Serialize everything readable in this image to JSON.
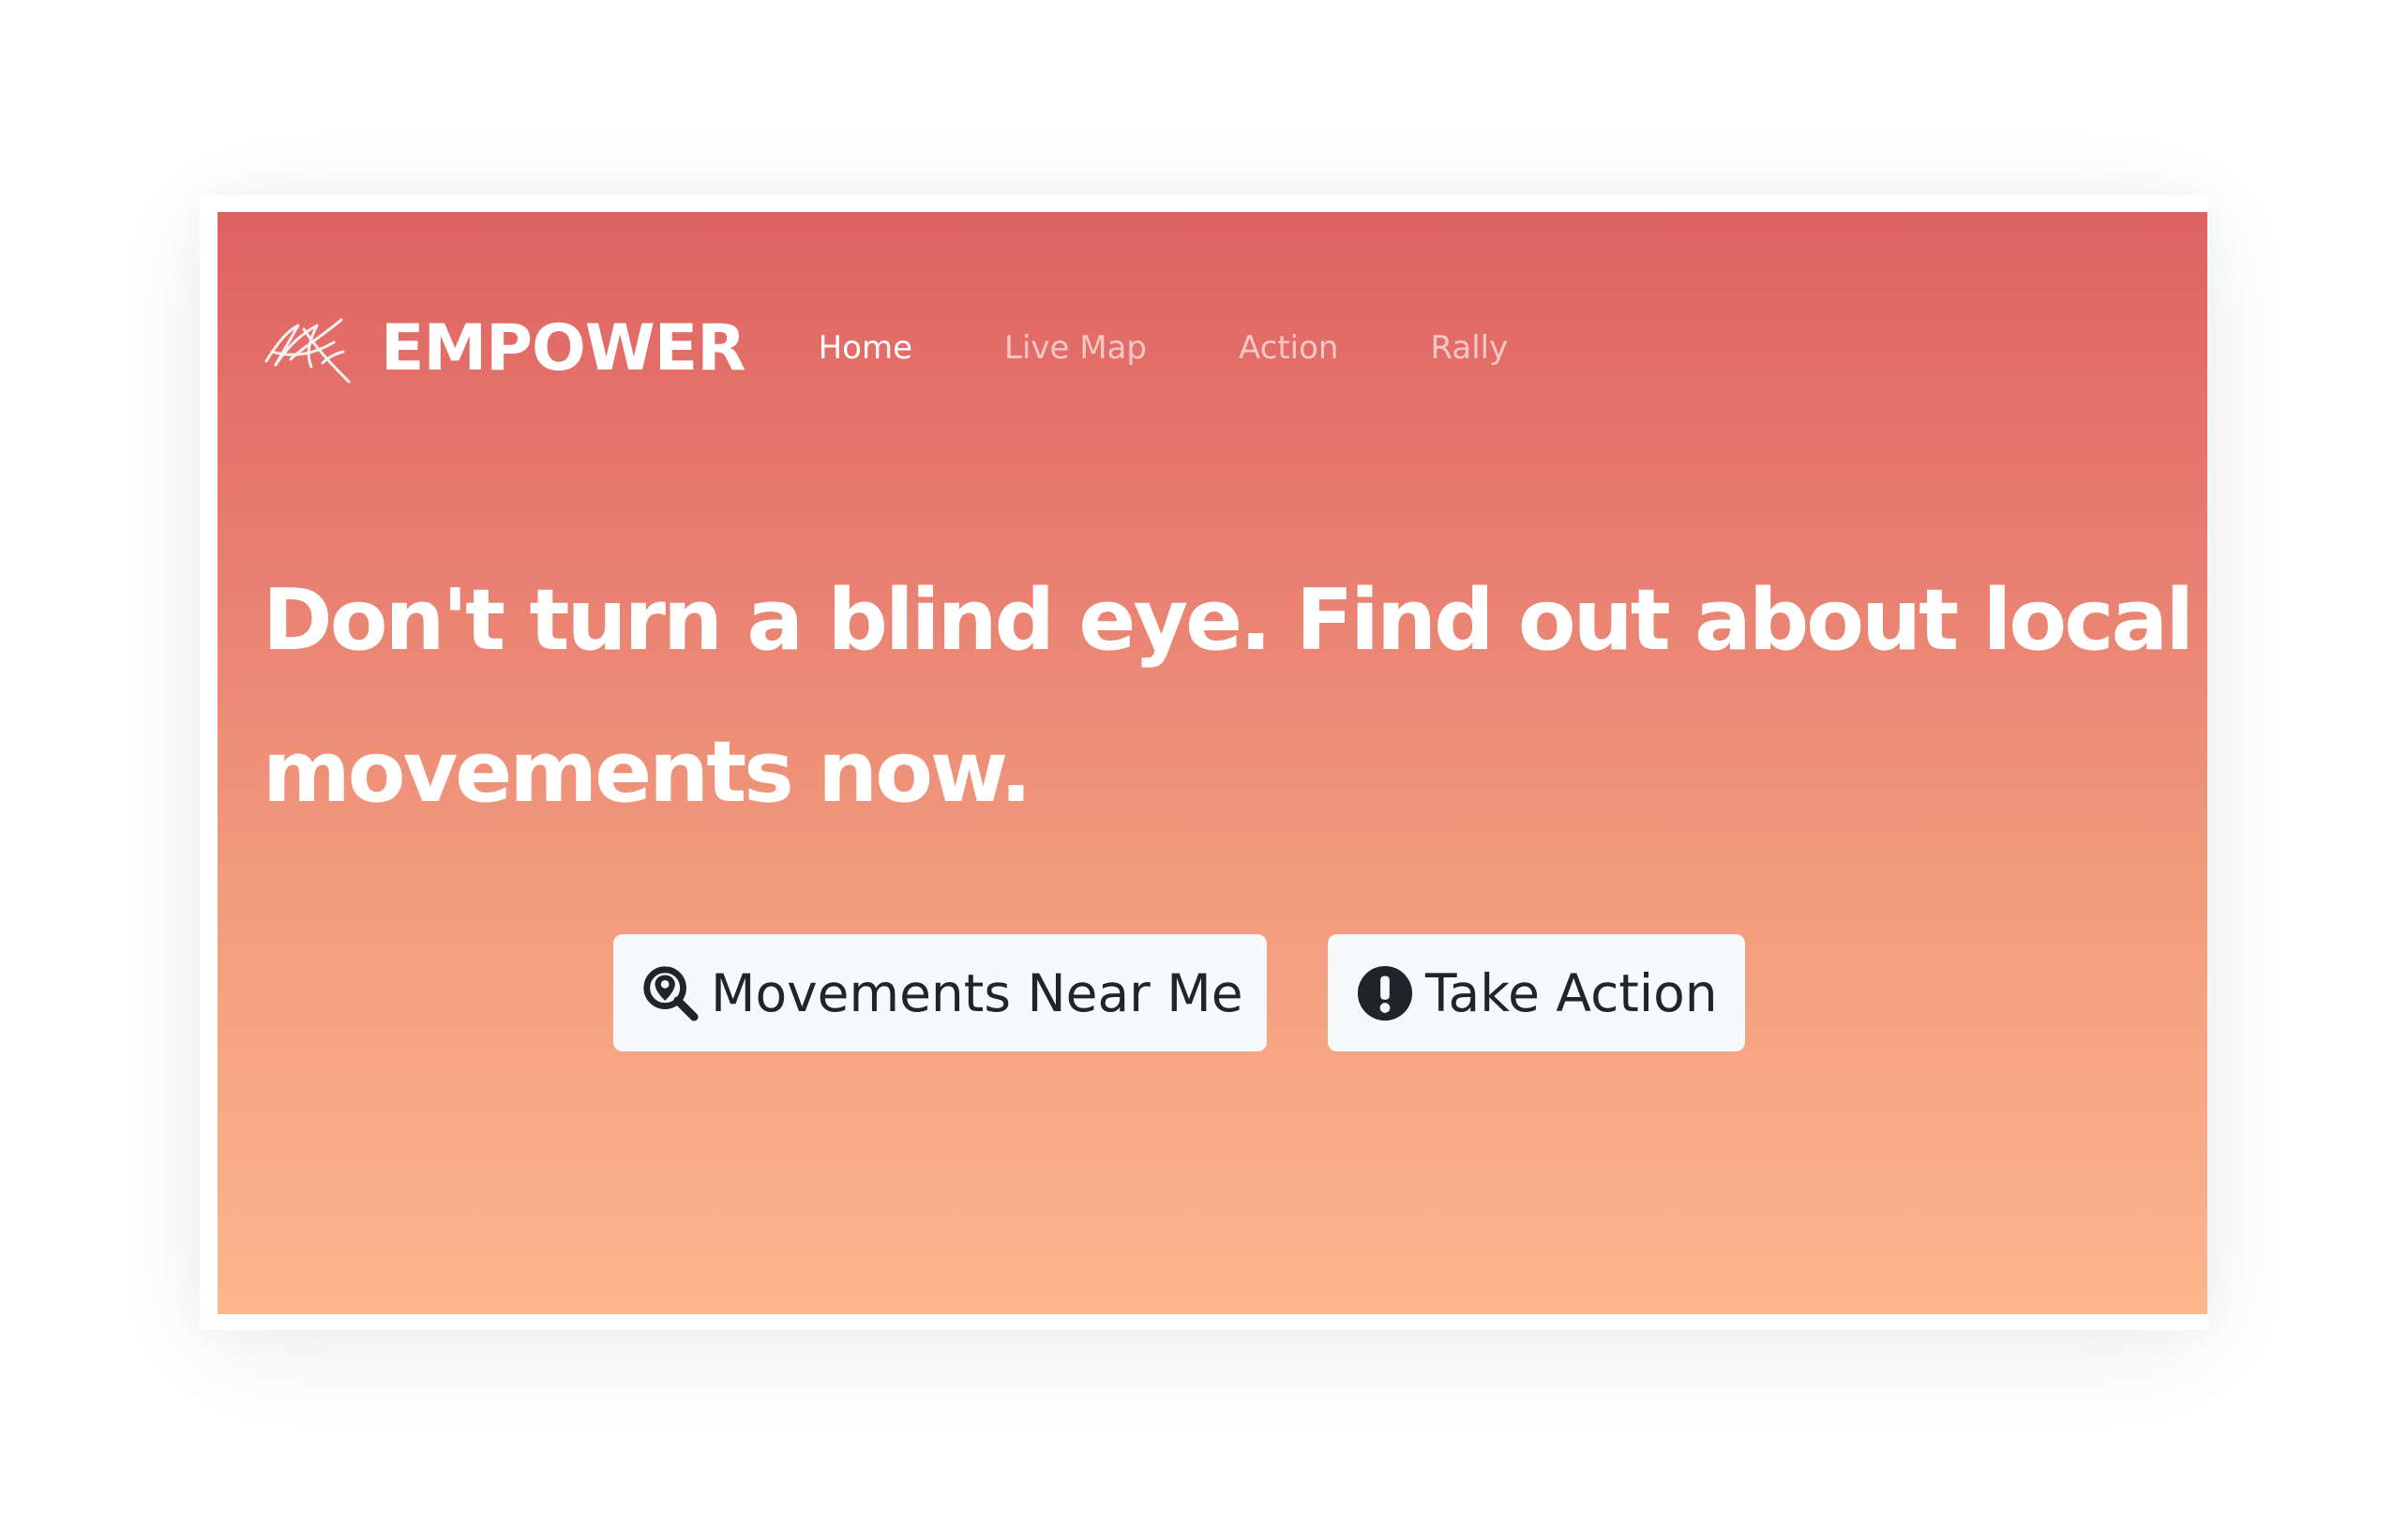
{
  "brand": {
    "name": "EMPOWER",
    "logo_icon": "scribble-logo-icon"
  },
  "nav": {
    "items": [
      {
        "label": "Home",
        "active": true
      },
      {
        "label": "Live Map",
        "active": false
      },
      {
        "label": "Action",
        "active": false
      },
      {
        "label": "Rally",
        "active": false
      }
    ]
  },
  "hero": {
    "headline_line1": "Don't turn a blind eye. Find out about local",
    "headline_line2": "movements now.",
    "gradient_top": "#df6262",
    "gradient_bottom": "#fdb68c"
  },
  "buttons": {
    "movements": {
      "label": "Movements Near Me",
      "icon": "search-location-icon"
    },
    "take_action": {
      "label": "Take Action",
      "icon": "exclamation-circle-icon"
    }
  }
}
